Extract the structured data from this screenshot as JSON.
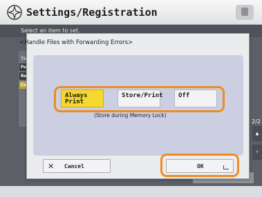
{
  "header": {
    "title": "Settings/Registration"
  },
  "background": {
    "instruction": "Select an item to set.",
    "list_items": [
      "Tim",
      "Funct",
      "Rece",
      "Com"
    ],
    "page_indicator": "2/2"
  },
  "dialog": {
    "title": "<Handle Files with Forwarding Errors>",
    "options": [
      {
        "label": "Always Print",
        "selected": true
      },
      {
        "label": "Store/Print",
        "selected": false
      },
      {
        "label": "Off",
        "selected": false
      }
    ],
    "note": "(Store during Memory Lock)",
    "cancel_label": "Cancel",
    "ok_label": "OK"
  },
  "colors": {
    "selected": "#f6d830",
    "highlight": "#ef8b21",
    "panel": "#cbcfe1"
  }
}
